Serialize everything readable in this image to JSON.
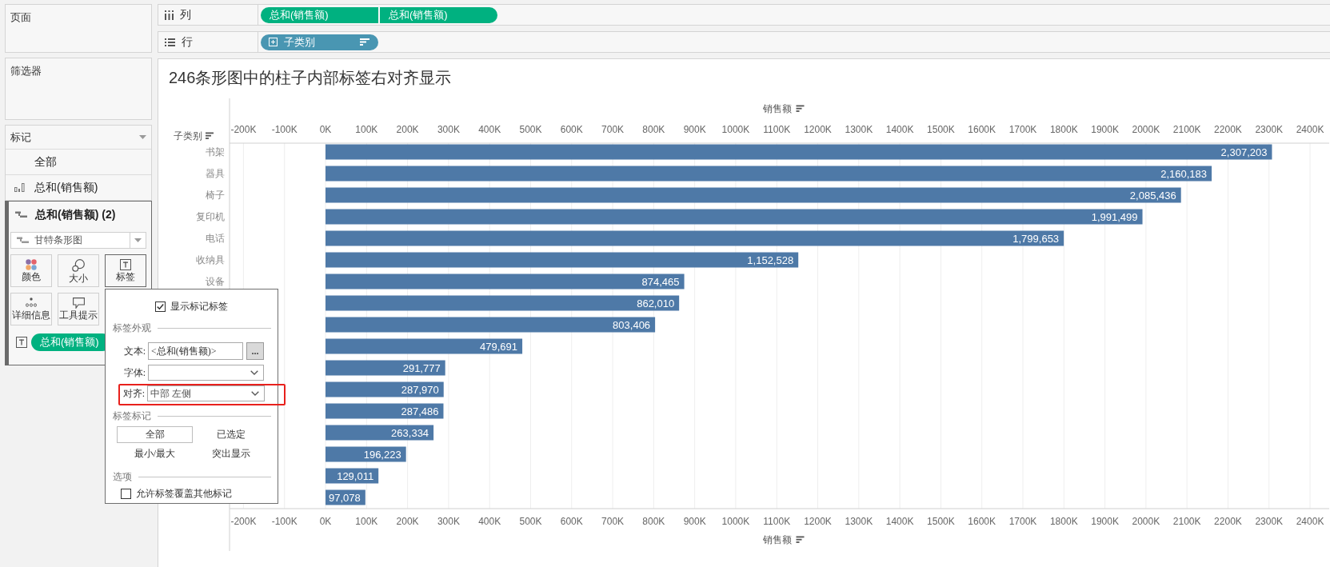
{
  "left_panel": {
    "pages": {
      "title": "页面"
    },
    "filters": {
      "title": "筛选器"
    },
    "marks": {
      "title": "标记",
      "layers": [
        {
          "kind": "all",
          "label": "全部",
          "selected": false
        },
        {
          "kind": "bar",
          "label": "总和(销售额)",
          "selected": false
        },
        {
          "kind": "gantt",
          "label": "总和(销售额) (2)",
          "selected": true
        }
      ],
      "mark_type": "甘特条形图",
      "buttons": [
        {
          "kind": "color",
          "label": "颜色",
          "active": false
        },
        {
          "kind": "size",
          "label": "大小",
          "active": false
        },
        {
          "kind": "label",
          "label": "标签",
          "active": true
        },
        {
          "kind": "detail",
          "label": "详细信息",
          "active": false
        },
        {
          "kind": "tooltip",
          "label": "工具提示",
          "active": false
        }
      ],
      "fields": [
        {
          "kind": "label",
          "label": "总和(销售额)"
        }
      ]
    }
  },
  "shelves": [
    {
      "kind": "columns",
      "label": "列",
      "pills": [
        {
          "kind": "measure",
          "label": "总和(销售额)"
        },
        {
          "kind": "measure",
          "label": "总和(销售额)"
        }
      ]
    },
    {
      "kind": "rows",
      "label": "行",
      "pills": [
        {
          "kind": "dimension",
          "label": "子类别",
          "expandable": true,
          "sorted": true
        }
      ]
    }
  ],
  "view": {
    "title": "246条形图中的柱子内部标签右对齐显示",
    "row_header": "子类别",
    "chart_data": {
      "type": "bar",
      "orientation": "horizontal",
      "grid": true,
      "xlabel": "销售额",
      "categories": [
        "书架",
        "器具",
        "椅子",
        "复印机",
        "电话",
        "收纳具",
        "设备",
        null,
        null,
        null,
        null,
        null,
        null,
        null,
        null,
        null,
        null
      ],
      "values": [
        2307203,
        2160183,
        2085436,
        1991499,
        1799653,
        1152528,
        874465,
        862010,
        803406,
        479691,
        291777,
        287970,
        287486,
        263334,
        196223,
        129011,
        97078
      ],
      "value_labels": [
        "2,307,203",
        "2,160,183",
        "2,085,436",
        "1,991,499",
        "1,799,653",
        "1,152,528",
        "874,465",
        "862,010",
        "803,406",
        "479,691",
        "291,777",
        "287,970",
        "287,486",
        "263,334",
        "196,223",
        "129,011",
        "97,078"
      ],
      "xlim": [
        -234000,
        2435000
      ],
      "xticks": [
        {
          "value": -200000,
          "label": "-200K"
        },
        {
          "value": -100000,
          "label": "-100K"
        },
        {
          "value": 0,
          "label": "0K"
        },
        {
          "value": 100000,
          "label": "100K"
        },
        {
          "value": 200000,
          "label": "200K"
        },
        {
          "value": 300000,
          "label": "300K"
        },
        {
          "value": 400000,
          "label": "400K"
        },
        {
          "value": 500000,
          "label": "500K"
        },
        {
          "value": 600000,
          "label": "600K"
        },
        {
          "value": 700000,
          "label": "700K"
        },
        {
          "value": 800000,
          "label": "800K"
        },
        {
          "value": 900000,
          "label": "900K"
        },
        {
          "value": 1000000,
          "label": "1000K"
        },
        {
          "value": 1100000,
          "label": "1100K"
        },
        {
          "value": 1200000,
          "label": "1200K"
        },
        {
          "value": 1300000,
          "label": "1300K"
        },
        {
          "value": 1400000,
          "label": "1400K"
        },
        {
          "value": 1500000,
          "label": "1500K"
        },
        {
          "value": 1600000,
          "label": "1600K"
        },
        {
          "value": 1700000,
          "label": "1700K"
        },
        {
          "value": 1800000,
          "label": "1800K"
        },
        {
          "value": 1900000,
          "label": "1900K"
        },
        {
          "value": 2000000,
          "label": "2000K"
        },
        {
          "value": 2100000,
          "label": "2100K"
        },
        {
          "value": 2200000,
          "label": "2200K"
        },
        {
          "value": 2300000,
          "label": "2300K"
        },
        {
          "value": 2400000,
          "label": "2400K"
        }
      ]
    },
    "bottom_axis": {
      "title": "销售额",
      "ticks": [
        "-200K",
        "-100K",
        "0K",
        "100K",
        "200K",
        "300K",
        "400K",
        "500K",
        "600K",
        "700K",
        "800K",
        "900K",
        "1000K",
        "1100K",
        "1200K",
        "1300K",
        "1400K",
        "1500K",
        "1600K",
        "1700K",
        "1800K",
        "1900K",
        "2000K",
        "2100K",
        "2200K",
        "2300K",
        "2400K"
      ]
    }
  },
  "label_popup": {
    "show_labels": {
      "label": "显示标记标签",
      "checked": true
    },
    "appearance": {
      "heading": "标签外观",
      "text": {
        "label": "文本:",
        "value": "<总和(销售额)>",
        "button": "..."
      },
      "font": {
        "label": "字体:"
      },
      "alignment": {
        "label": "对齐:",
        "value": "中部 左侧",
        "highlighted": true
      }
    },
    "label_marks": {
      "heading": "标签标记",
      "options": [
        {
          "label": "全部",
          "selected": true
        },
        {
          "label": "已选定",
          "selected": false
        },
        {
          "label": "最小/最大",
          "selected": false
        },
        {
          "label": "突出显示",
          "selected": false
        }
      ]
    },
    "options": {
      "heading": "选项",
      "allow_overlap": {
        "label": "允许标签覆盖其他标记",
        "checked": false
      }
    }
  }
}
